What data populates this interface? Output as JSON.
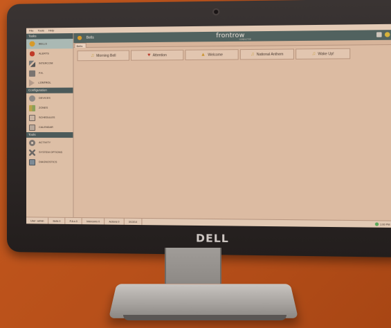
{
  "menu": [
    "File",
    "Tools",
    "Help"
  ],
  "sidebar": {
    "sections": [
      {
        "title": "Tasks",
        "items": [
          {
            "label": "BELLS",
            "icon": "bell-icon",
            "active": true
          },
          {
            "label": "ALERTS",
            "icon": "alert-icon"
          },
          {
            "label": "INTERCOM",
            "icon": "microphone-icon"
          },
          {
            "label": "P.A.",
            "icon": "pa-icon"
          },
          {
            "label": "CONTROL",
            "icon": "play-icon"
          }
        ]
      },
      {
        "title": "Configuration",
        "items": [
          {
            "label": "DEVICES",
            "icon": "device-icon"
          },
          {
            "label": "ZONES",
            "icon": "zones-icon"
          },
          {
            "label": "SCHEDULES",
            "icon": "schedule-icon"
          },
          {
            "label": "CALENDAR",
            "icon": "calendar-icon"
          }
        ]
      },
      {
        "title": "Tools",
        "items": [
          {
            "label": "ACTIVITY",
            "icon": "gear-icon"
          },
          {
            "label": "SYSTEM OPTIONS",
            "icon": "wrench-icon"
          },
          {
            "label": "DIAGNOSTICS",
            "icon": "monitor-icon"
          }
        ]
      }
    ]
  },
  "header": {
    "title": "Bells",
    "brand": "frontrow",
    "brand_sub": "CONDUCTOR"
  },
  "tab": "Bells",
  "bells": [
    {
      "label": "Morning Bell",
      "icon": "music-note-icon",
      "color": "#c9a24a"
    },
    {
      "label": "Attention",
      "icon": "heart-icon",
      "color": "#b73a2a"
    },
    {
      "label": "Welcome",
      "icon": "bell-icon",
      "color": "#c99430"
    },
    {
      "label": "National Anthem",
      "icon": "music-note-icon",
      "color": "#c9a24a"
    },
    {
      "label": "Wake Up!",
      "icon": "music-note-icon",
      "color": "#c9a24a"
    }
  ],
  "status": {
    "user": "User: admin",
    "bells": "Bells 0",
    "pas": "P.A.s 0",
    "intercoms": "Intercoms 0",
    "actions": "Actions 0",
    "date": "3/13/14",
    "time": "1:00 PM"
  },
  "device": {
    "logo": "DELL"
  }
}
